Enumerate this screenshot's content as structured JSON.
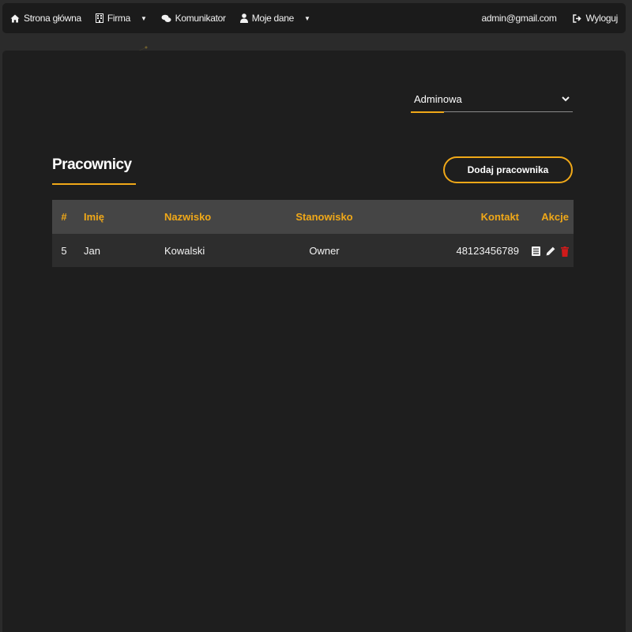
{
  "navbar": {
    "home": "Strona główna",
    "company": "Firma",
    "messenger": "Komunikator",
    "my_data": "Moje dane",
    "user_email": "admin@gmail.com",
    "logout": "Wyloguj"
  },
  "company_select": {
    "value": "Adminowa"
  },
  "section": {
    "title": "Pracownicy",
    "add_button": "Dodaj pracownika"
  },
  "table": {
    "headers": [
      "#",
      "Imię",
      "Nazwisko",
      "Stanowisko",
      "Kontakt",
      "Akcje"
    ],
    "rows": [
      {
        "id": "5",
        "first_name": "Jan",
        "last_name": "Kowalski",
        "position": "Owner",
        "contact": "48123456789"
      }
    ]
  },
  "colors": {
    "accent": "#f0a818",
    "delete": "#d11a1a",
    "panel": "#1e1e1e",
    "navbar": "#1b1b1b"
  },
  "icons": [
    "home-icon",
    "building-icon",
    "comments-icon",
    "user-icon",
    "logout-icon",
    "details-icon",
    "edit-icon",
    "delete-icon",
    "chevron-down-icon"
  ]
}
